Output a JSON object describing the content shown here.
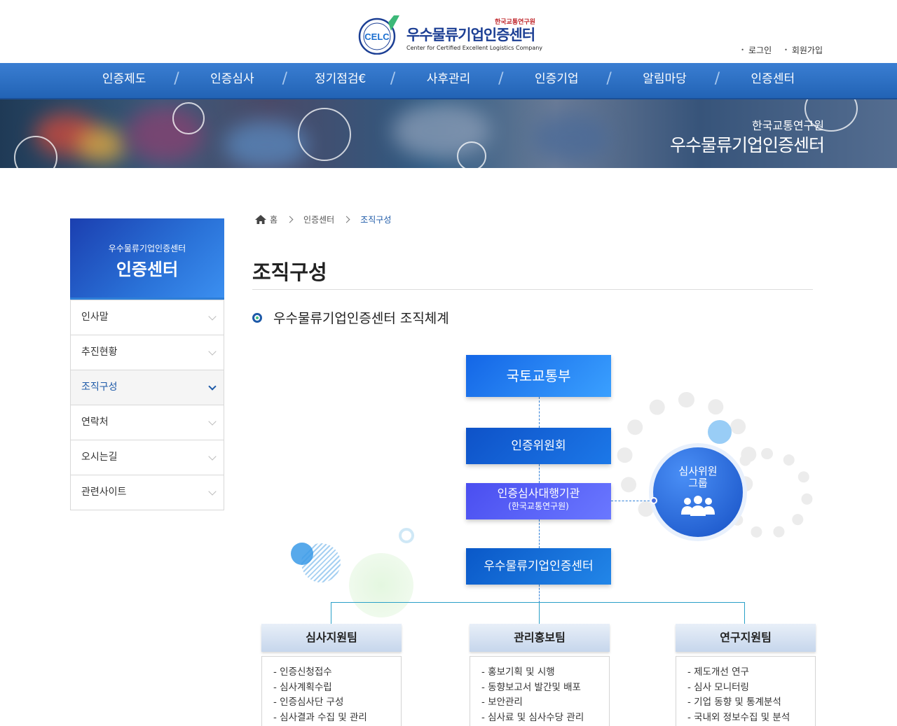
{
  "header": {
    "logo_emblem_text": "CELC",
    "logo_org": "한국교통연구원",
    "logo_title": "우수물류기업인증센터",
    "logo_subtitle": "Center for Certified Excellent Logistics Company",
    "util_links": [
      "로그인",
      "회원가입"
    ]
  },
  "gnb": [
    "인증제도",
    "인증심사",
    "정기점검€",
    "사후관리",
    "인증기업",
    "알림마당",
    "인증센터"
  ],
  "banner": {
    "subtitle": "한국교통연구원",
    "title": "우수물류기업인증센터"
  },
  "sidebar": {
    "head_sub": "우수물류기업인증센터",
    "head_title": "인증센터",
    "items": [
      {
        "label": "인사말",
        "active": false
      },
      {
        "label": "추진현황",
        "active": false
      },
      {
        "label": "조직구성",
        "active": true
      },
      {
        "label": "연락처",
        "active": false
      },
      {
        "label": "오시는길",
        "active": false
      },
      {
        "label": "관련사이트",
        "active": false
      }
    ]
  },
  "breadcrumb": [
    "홈",
    "인증센터",
    "조직구성"
  ],
  "page_title": "조직구성",
  "section_title": "우수물류기업인증센터 조직체계",
  "org": {
    "top": "국토교통부",
    "committee": "인증위원회",
    "agency": "인증심사대행기관",
    "agency_sub": "(한국교통연구원)",
    "center": "우수물류기업인증센터",
    "group_line1": "심사위원",
    "group_line2": "그룹",
    "teams": [
      {
        "name": "심사지원팀",
        "duties": [
          "- 인증신청접수",
          "- 심사계획수립",
          "- 인증심사단 구성",
          "- 심사결과 수집 및 관리"
        ]
      },
      {
        "name": "관리홍보팀",
        "duties": [
          "- 홍보기획 및 시행",
          "- 동향보고서 발간및 배포",
          "- 보안관리",
          "- 심사료 및 심사수당 관리"
        ]
      },
      {
        "name": "연구지원팀",
        "duties": [
          "- 제도개선 연구",
          "- 심사 모니터링",
          "- 기업 동향 및 통계분석",
          "- 국내외 정보수집 및 분석"
        ]
      }
    ]
  },
  "colors": {
    "gnb_blue": "#2b6fc4",
    "accent_blue": "#1e5aa8",
    "logo_red": "#c0282d"
  }
}
